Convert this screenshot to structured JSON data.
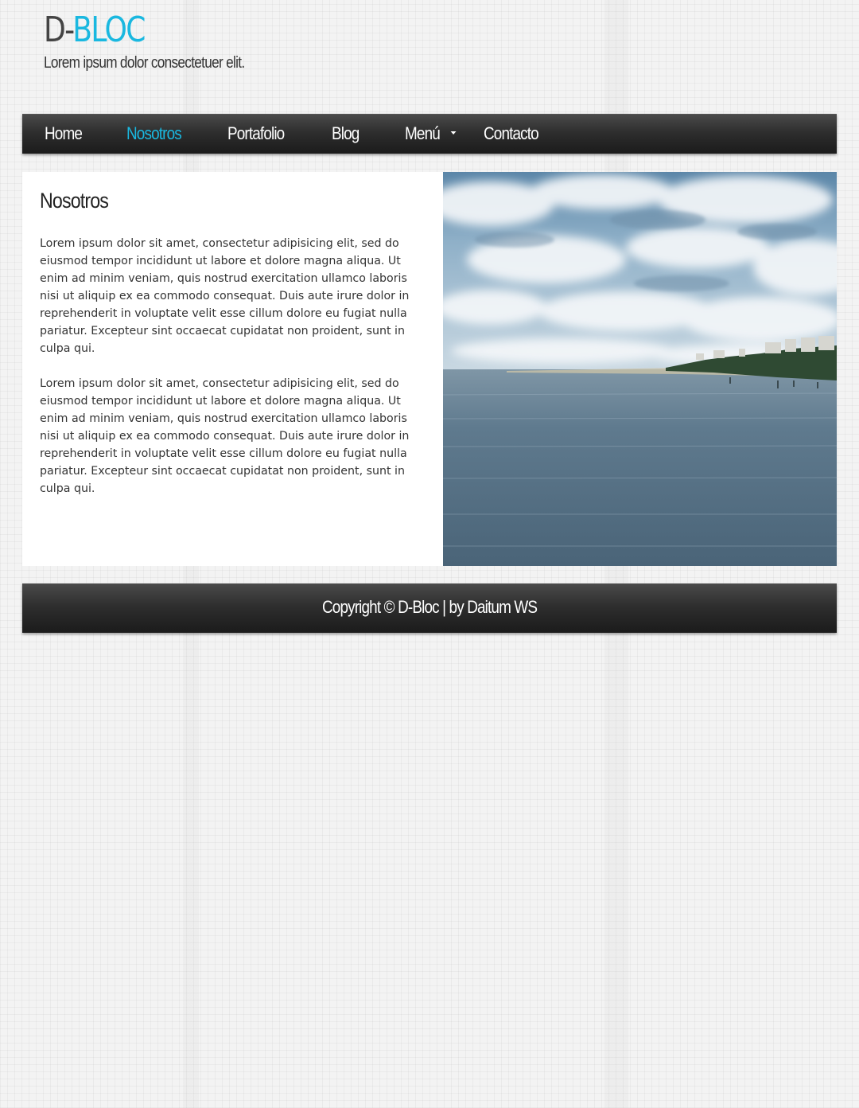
{
  "header": {
    "logo_prefix": "D-",
    "logo_accent": "BLOC",
    "tagline": "Lorem ipsum dolor consectetuer elit."
  },
  "nav": {
    "items": [
      {
        "label": "Home",
        "active": false
      },
      {
        "label": "Nosotros",
        "active": true
      },
      {
        "label": "Portafolio",
        "active": false
      },
      {
        "label": "Blog",
        "active": false
      },
      {
        "label": "Menú",
        "active": false,
        "has_dropdown": true
      },
      {
        "label": "Contacto",
        "active": false
      }
    ]
  },
  "main": {
    "title": "Nosotros",
    "paragraphs": [
      "Lorem ipsum dolor sit amet, consectetur adipisicing elit, sed do eiusmod tempor incididunt ut labore et dolore magna aliqua. Ut enim ad minim veniam, quis nostrud exercitation ullamco laboris nisi ut aliquip ex ea commodo consequat. Duis aute irure dolor in reprehenderit in voluptate velit esse cillum dolore eu fugiat nulla pariatur. Excepteur sint occaecat cupidatat non proident, sunt in culpa qui.",
      "Lorem ipsum dolor sit amet, consectetur adipisicing elit, sed do eiusmod tempor incididunt ut labore et dolore magna aliqua. Ut enim ad minim veniam, quis nostrud exercitation ullamco laboris nisi ut aliquip ex ea commodo consequat. Duis aute irure dolor in reprehenderit in voluptate velit esse cillum dolore eu fugiat nulla pariatur. Excepteur sint occaecat cupidatat non proident, sunt in culpa qui."
    ],
    "image_subject": "seaside-photo"
  },
  "footer": {
    "text": "Copyright © D-Bloc | by Daitum WS"
  },
  "colors": {
    "accent": "#1ab8e0",
    "nav_bg": "#2e2e2e",
    "page_bg": "#f3f3f3"
  }
}
